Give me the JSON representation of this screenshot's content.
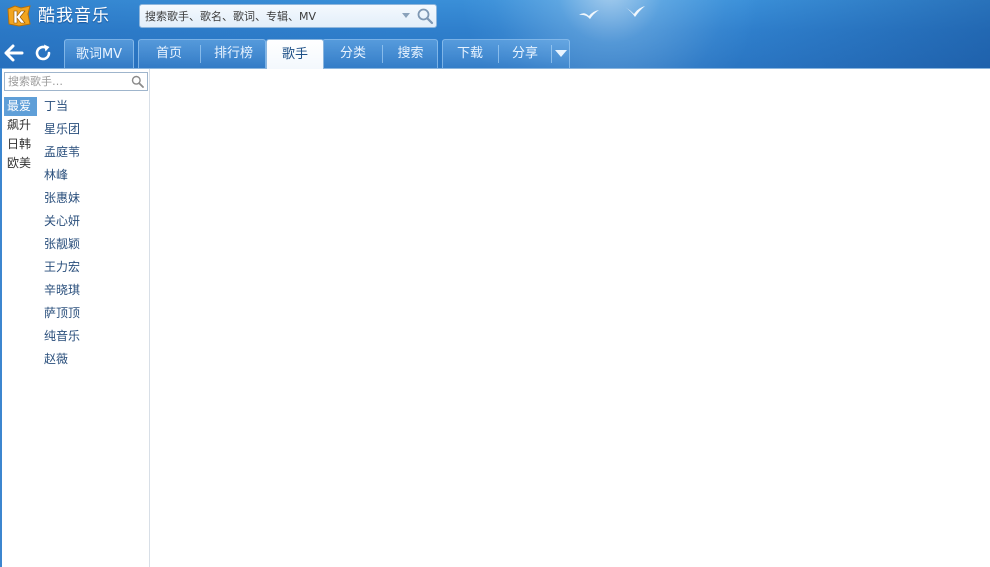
{
  "app": {
    "title": "酷我音乐",
    "colors": {
      "banner": "#2f7fcc",
      "active_category": "#5f9fd8",
      "singer_link": "#2a4f7c"
    }
  },
  "search": {
    "placeholder": "搜索歌手、歌名、歌词、专辑、MV",
    "value": "",
    "button_icon": "magnifier-icon",
    "dropdown_icon": "chevron-down-icon"
  },
  "nav": {
    "back_icon": "back-arrow-icon",
    "refresh_icon": "refresh-icon"
  },
  "tabs": [
    {
      "label": "歌词MV",
      "active": false
    },
    {
      "label": "首页",
      "active": false
    },
    {
      "label": "排行榜",
      "active": false
    },
    {
      "label": "歌手",
      "active": true
    },
    {
      "label": "分类",
      "active": false
    },
    {
      "label": "搜索",
      "active": false
    },
    {
      "label": "下载",
      "active": false
    },
    {
      "label": "分享",
      "active": false
    }
  ],
  "tabs_more_icon": "triangle-down-icon",
  "singer_panel": {
    "search_placeholder": "搜索歌手…",
    "categories": [
      {
        "label": "最爱",
        "active": true
      },
      {
        "label": "飙升",
        "active": false
      },
      {
        "label": "日韩",
        "active": false
      },
      {
        "label": "欧美",
        "active": false
      }
    ],
    "singers": [
      "丁当",
      "星乐团",
      "孟庭苇",
      "林峰",
      "张惠妹",
      "关心妍",
      "张靓颖",
      "王力宏",
      "辛晓琪",
      "萨顶顶",
      "纯音乐",
      "赵薇"
    ]
  }
}
